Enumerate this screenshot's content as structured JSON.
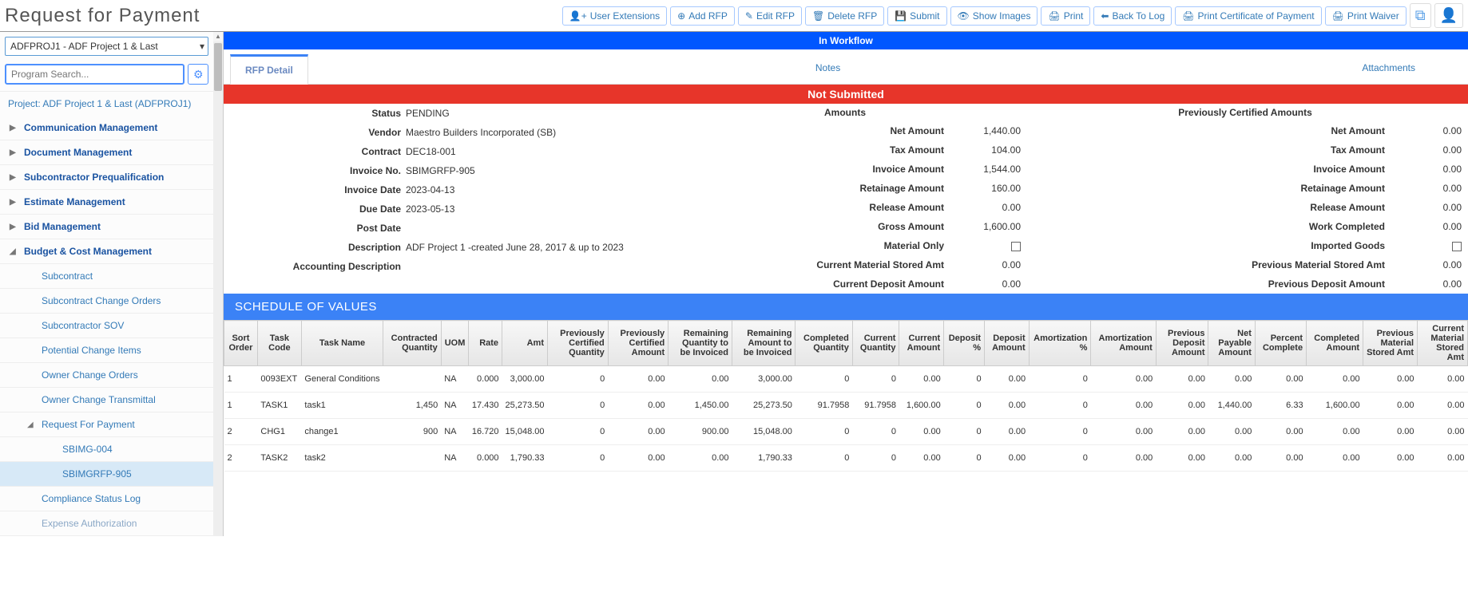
{
  "header": {
    "title": "Request for Payment",
    "buttons": {
      "user_ext": "User Extensions",
      "add_rfp": "Add RFP",
      "edit_rfp": "Edit RFP",
      "delete_rfp": "Delete RFP",
      "submit": "Submit",
      "show_images": "Show Images",
      "print": "Print",
      "back_to_log": "Back To Log",
      "print_cert": "Print Certificate of Payment",
      "print_waiver": "Print Waiver"
    }
  },
  "sidebar": {
    "project_select": "ADFPROJ1 - ADF Project 1 & Last",
    "search_placeholder": "Program Search...",
    "project_line": "Project: ADF Project 1 & Last (ADFPROJ1)",
    "items": {
      "comm": "Communication Management",
      "doc": "Document Management",
      "subpre": "Subcontractor Prequalification",
      "est": "Estimate Management",
      "bid": "Bid Management",
      "bcm": "Budget & Cost Management",
      "subs": {
        "subcontract": "Subcontract",
        "sco": "Subcontract Change Orders",
        "sov": "Subcontractor SOV",
        "pci": "Potential Change Items",
        "oco": "Owner Change Orders",
        "oct": "Owner Change Transmittal",
        "rfp": "Request For Payment",
        "rfp_children": {
          "a": "SBIMG-004",
          "b": "SBIMGRFP-905"
        },
        "csl": "Compliance Status Log",
        "ea": "Expense Authorization"
      }
    }
  },
  "workflow_banner": "In Workflow",
  "tabs": {
    "rfp_detail": "RFP Detail",
    "notes": "Notes",
    "attachments": "Attachments"
  },
  "status_banner": "Not Submitted",
  "details": {
    "status_label": "Status",
    "status_value": "PENDING",
    "vendor_label": "Vendor",
    "vendor_value": "Maestro Builders Incorporated (SB)",
    "contract_label": "Contract",
    "contract_value": "DEC18-001",
    "invoice_no_label": "Invoice No.",
    "invoice_no_value": "SBIMGRFP-905",
    "invoice_date_label": "Invoice Date",
    "invoice_date_value": "2023-04-13",
    "due_date_label": "Due Date",
    "due_date_value": "2023-05-13",
    "post_date_label": "Post Date",
    "post_date_value": "",
    "desc_label": "Description",
    "desc_value": "ADF Project 1 -created June 28, 2017 & up to 2023",
    "acct_desc_label": "Accounting Description",
    "acct_desc_value": ""
  },
  "amounts": {
    "header": "Amounts",
    "net_label": "Net Amount",
    "net_value": "1,440.00",
    "tax_label": "Tax Amount",
    "tax_value": "104.00",
    "inv_label": "Invoice Amount",
    "inv_value": "1,544.00",
    "ret_label": "Retainage Amount",
    "ret_value": "160.00",
    "rel_label": "Release Amount",
    "rel_value": "0.00",
    "gross_label": "Gross Amount",
    "gross_value": "1,600.00",
    "mat_label": "Material Only",
    "cms_label": "Current Material Stored Amt",
    "cms_value": "0.00",
    "cda_label": "Current Deposit Amount",
    "cda_value": "0.00"
  },
  "prev": {
    "header": "Previously Certified Amounts",
    "net_label": "Net Amount",
    "net_value": "0.00",
    "tax_label": "Tax Amount",
    "tax_value": "0.00",
    "inv_label": "Invoice Amount",
    "inv_value": "0.00",
    "ret_label": "Retainage Amount",
    "ret_value": "0.00",
    "rel_label": "Release Amount",
    "rel_value": "0.00",
    "wc_label": "Work Completed",
    "wc_value": "0.00",
    "ig_label": "Imported Goods",
    "pms_label": "Previous Material Stored Amt",
    "pms_value": "0.00",
    "pda_label": "Previous Deposit Amount",
    "pda_value": "0.00"
  },
  "sov": {
    "header": "SCHEDULE OF VALUES",
    "columns": [
      "Sort Order",
      "Task Code",
      "Task Name",
      "Contracted Quantity",
      "UOM",
      "Rate",
      "Amt",
      "Previously Certified Quantity",
      "Previously Certified Amount",
      "Remaining Quantity to be Invoiced",
      "Remaining Amount to be Invoiced",
      "Completed Quantity",
      "Current Quantity",
      "Current Amount",
      "Deposit %",
      "Deposit Amount",
      "Amortization %",
      "Amortization Amount",
      "Previous Deposit Amount",
      "Net Payable Amount",
      "Percent Complete",
      "Completed Amount",
      "Previous Material Stored Amt",
      "Current Material Stored Amt"
    ],
    "rows": [
      [
        "1",
        "0093EXT",
        "General Conditions",
        "",
        "NA",
        "0.000",
        "3,000.00",
        "0",
        "0.00",
        "0.00",
        "3,000.00",
        "0",
        "0",
        "0.00",
        "0",
        "0.00",
        "0",
        "0.00",
        "0.00",
        "0.00",
        "0.00",
        "0.00",
        "0.00",
        "0.00"
      ],
      [
        "1",
        "TASK1",
        "task1",
        "1,450",
        "NA",
        "17.430",
        "25,273.50",
        "0",
        "0.00",
        "1,450.00",
        "25,273.50",
        "91.7958",
        "91.7958",
        "1,600.00",
        "0",
        "0.00",
        "0",
        "0.00",
        "0.00",
        "1,440.00",
        "6.33",
        "1,600.00",
        "0.00",
        "0.00"
      ],
      [
        "2",
        "CHG1",
        "change1",
        "900",
        "NA",
        "16.720",
        "15,048.00",
        "0",
        "0.00",
        "900.00",
        "15,048.00",
        "0",
        "0",
        "0.00",
        "0",
        "0.00",
        "0",
        "0.00",
        "0.00",
        "0.00",
        "0.00",
        "0.00",
        "0.00",
        "0.00"
      ],
      [
        "2",
        "TASK2",
        "task2",
        "",
        "NA",
        "0.000",
        "1,790.33",
        "0",
        "0.00",
        "0.00",
        "1,790.33",
        "0",
        "0",
        "0.00",
        "0",
        "0.00",
        "0",
        "0.00",
        "0.00",
        "0.00",
        "0.00",
        "0.00",
        "0.00",
        "0.00"
      ]
    ]
  }
}
